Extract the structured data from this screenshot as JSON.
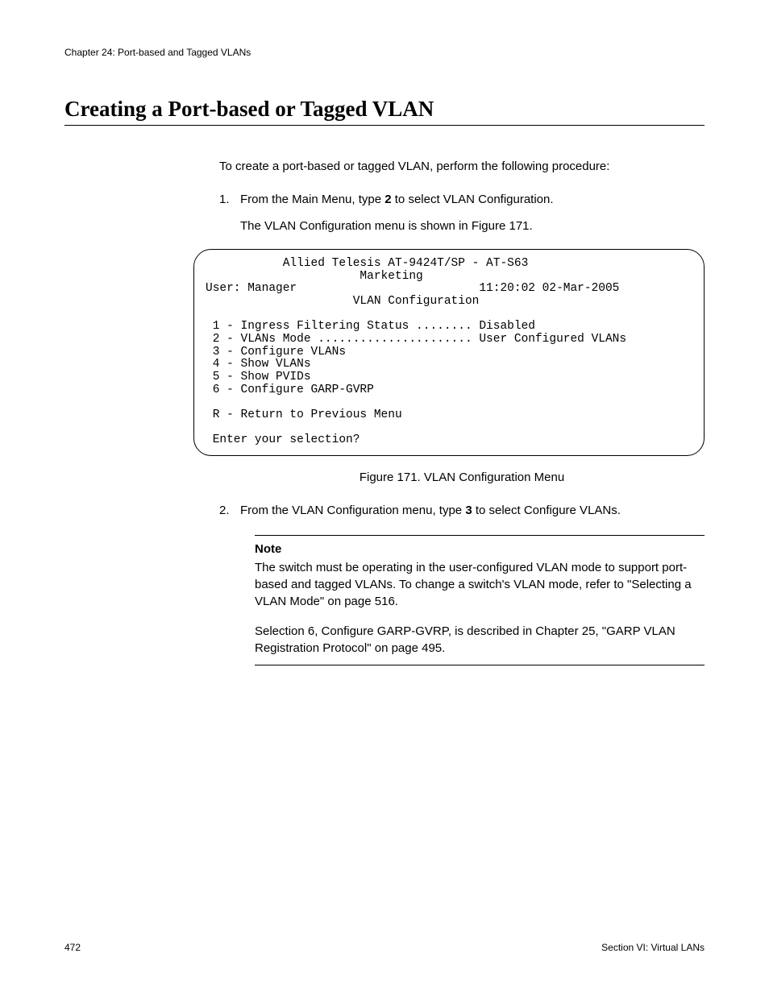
{
  "header": {
    "chapter": "Chapter 24: Port-based and Tagged VLANs"
  },
  "title": "Creating a Port-based or Tagged VLAN",
  "intro": "To create a port-based or tagged VLAN, perform the following procedure:",
  "steps": {
    "s1": {
      "num": "1.",
      "pre": "From the Main Menu, type ",
      "bold": "2",
      "post": " to select VLAN Configuration.",
      "sub": "The VLAN Configuration menu is shown in Figure 171."
    },
    "s2": {
      "num": "2.",
      "pre": "From the VLAN Configuration menu, type ",
      "bold": "3",
      "post": " to select Configure VLANs."
    }
  },
  "terminal": "           Allied Telesis AT-9424T/SP - AT-S63\n                      Marketing\nUser: Manager                          11:20:02 02-Mar-2005\n                     VLAN Configuration\n\n 1 - Ingress Filtering Status ........ Disabled\n 2 - VLANs Mode ...................... User Configured VLANs\n 3 - Configure VLANs\n 4 - Show VLANs\n 5 - Show PVIDs\n 6 - Configure GARP-GVRP\n\n R - Return to Previous Menu\n\n Enter your selection?",
  "figure_caption": "Figure 171. VLAN Configuration Menu",
  "note": {
    "title": "Note",
    "p1": "The switch must be operating in the user-configured VLAN mode to support port-based and tagged VLANs. To change a switch's VLAN mode, refer to \"Selecting a VLAN Mode\" on page 516.",
    "p2": "Selection 6, Configure GARP-GVRP, is described in Chapter 25, \"GARP VLAN Registration Protocol\" on page 495."
  },
  "footer": {
    "page": "472",
    "section": "Section VI: Virtual LANs"
  }
}
